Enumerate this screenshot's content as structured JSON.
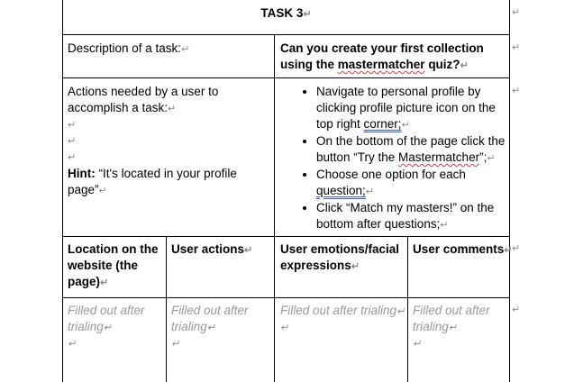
{
  "title": "TASK 3",
  "description_label": "Description of a task:",
  "question": {
    "prefix": "Can you create your first collection using the ",
    "word": "mastermatcher",
    "suffix": " quiz?"
  },
  "actions_label": "Actions needed by a user to accomplish a task:",
  "hint": {
    "label": "Hint:",
    "text": " “It's located in your profile page”"
  },
  "steps": [
    {
      "pre": "Navigate to personal profile by clicking profile picture icon on the top right ",
      "mark": "corner;",
      "post": ""
    },
    {
      "pre": "On the bottom of the page click the button “Try the ",
      "mark": "Mastermatcher",
      "post": "”;"
    },
    {
      "pre": "Choose one option for each ",
      "mark": "question;",
      "post": ""
    },
    {
      "pre": "Click “Match my masters!” on the bottom after questions;",
      "mark": "",
      "post": ""
    }
  ],
  "headers": {
    "location": "Location on the website (the page)",
    "actions": "User actions",
    "emotions": "User emotions/facial expressions",
    "comments": "User comments"
  },
  "placeholder": "Filled out after trialing",
  "pilcrow": "↵"
}
